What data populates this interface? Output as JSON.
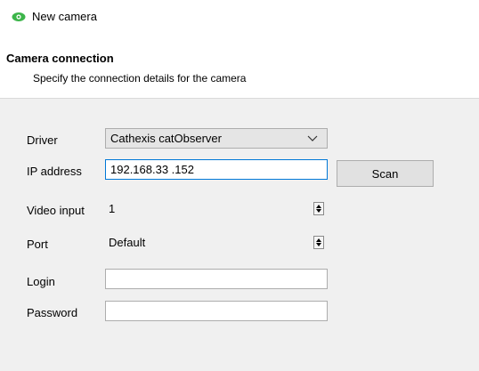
{
  "header": {
    "title": "New camera",
    "section_title": "Camera connection",
    "section_subtitle": "Specify the connection details for the camera",
    "title_icon": "eye-icon",
    "icon_color": "#3cb54a"
  },
  "form": {
    "driver": {
      "label": "Driver",
      "value": "Cathexis catObserver"
    },
    "ip": {
      "label": "IP address",
      "value": "192.168.33 .152",
      "button": "Scan"
    },
    "video_input": {
      "label": "Video input",
      "value": "1"
    },
    "port": {
      "label": "Port",
      "value": "Default"
    },
    "login": {
      "label": "Login",
      "value": ""
    },
    "password": {
      "label": "Password",
      "value": ""
    }
  }
}
